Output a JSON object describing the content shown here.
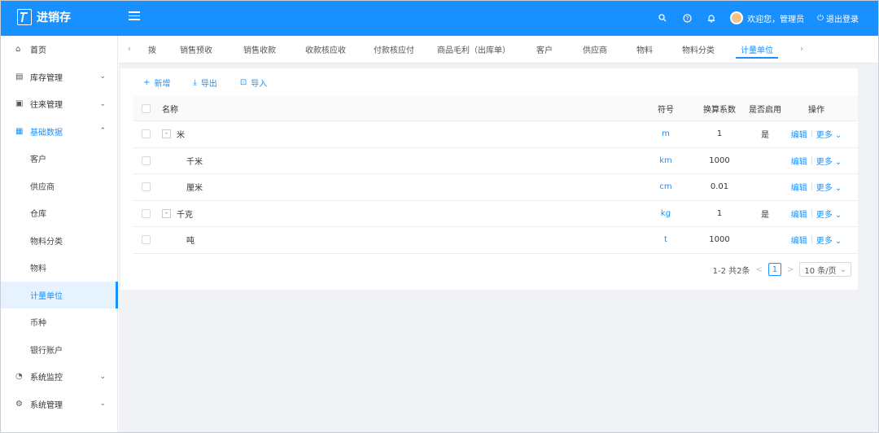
{
  "header": {
    "app_title": "进销存",
    "welcome": "欢迎您，管理员",
    "logout": "退出登录",
    "colors": {
      "accent": "#1890ff"
    }
  },
  "sidebar": {
    "items": [
      {
        "label": "首页",
        "icon": "home-icon",
        "glyph": "⌂"
      },
      {
        "label": "库存管理",
        "icon": "inventory-icon",
        "glyph": "▤",
        "arrow": "⌄"
      },
      {
        "label": "往来管理",
        "icon": "accounts-icon",
        "glyph": "▣",
        "arrow": "⌄"
      },
      {
        "label": "基础数据",
        "icon": "grid-icon",
        "glyph": "▦",
        "arrow": "⌃"
      }
    ],
    "sub_items": [
      "客户",
      "供应商",
      "仓库",
      "物料分类",
      "物料",
      "计量单位",
      "币种",
      "银行账户"
    ],
    "bottom_items": [
      {
        "label": "系统监控",
        "icon": "gauge-icon",
        "glyph": "◔",
        "arrow": "⌄"
      },
      {
        "label": "系统管理",
        "icon": "settings-icon",
        "glyph": "⚙",
        "arrow": "⌄"
      }
    ]
  },
  "tabs": [
    "拨",
    "销售预收",
    "销售收款",
    "收款核应收",
    "付款核应付",
    "商品毛利（出库单）",
    "客户",
    "供应商",
    "物料",
    "物料分类",
    "计量单位"
  ],
  "toolbar": {
    "add": "新增",
    "export": "导出",
    "import": "导入"
  },
  "table": {
    "headers": {
      "name": "名称",
      "symbol": "符号",
      "rate": "换算系数",
      "enabled": "是否启用",
      "ops": "操作"
    },
    "rows": [
      {
        "name": "米",
        "symbol": "m",
        "rate": "1",
        "enabled": "是",
        "edit": "编辑",
        "more": "更多"
      },
      {
        "name": "千米",
        "symbol": "km",
        "rate": "1000",
        "enabled": "",
        "edit": "编辑",
        "more": "更多"
      },
      {
        "name": "厘米",
        "symbol": "cm",
        "rate": "0.01",
        "enabled": "",
        "edit": "编辑",
        "more": "更多"
      },
      {
        "name": "千克",
        "symbol": "kg",
        "rate": "1",
        "enabled": "是",
        "edit": "编辑",
        "more": "更多"
      },
      {
        "name": "吨",
        "symbol": "t",
        "rate": "1000",
        "enabled": "",
        "edit": "编辑",
        "more": "更多"
      }
    ]
  },
  "pagination": {
    "summary": "1-2 共2条",
    "current": "1",
    "page_size": "10 条/页"
  }
}
